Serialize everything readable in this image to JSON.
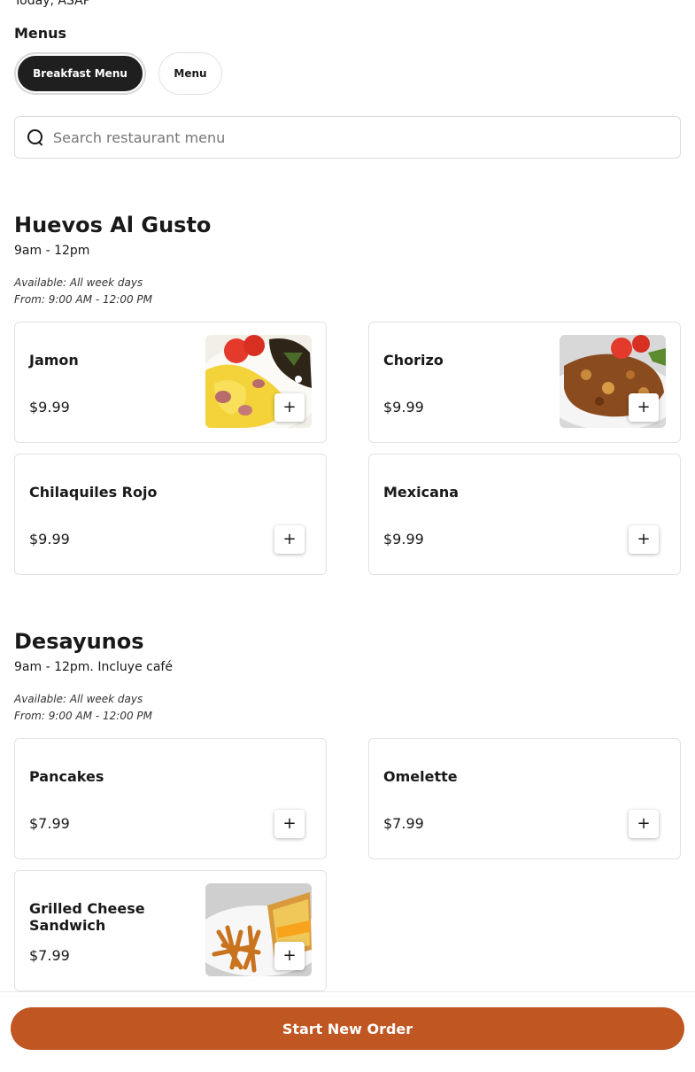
{
  "header": {
    "order_time": "Today, ASAP"
  },
  "menus": {
    "title": "Menus",
    "tabs": [
      {
        "label": "Breakfast Menu",
        "active": true
      },
      {
        "label": "Menu",
        "active": false
      }
    ]
  },
  "search": {
    "placeholder": "Search restaurant menu",
    "value": ""
  },
  "sections": [
    {
      "title": "Huevos Al Gusto",
      "description": "9am - 12pm",
      "available": "Available: All week days",
      "from": "From: 9:00 AM - 12:00 PM",
      "items": [
        {
          "name": "Jamon",
          "price": "$9.99",
          "image": "scrambled-eggs-ham-photo"
        },
        {
          "name": "Chorizo",
          "price": "$9.99",
          "image": "chorizo-eggs-photo"
        },
        {
          "name": "Chilaquiles Rojo",
          "price": "$9.99"
        },
        {
          "name": "Mexicana",
          "price": "$9.99"
        }
      ]
    },
    {
      "title": "Desayunos",
      "description": "9am - 12pm. Incluye café",
      "available": "Available: All week days",
      "from": "From: 9:00 AM - 12:00 PM",
      "items": [
        {
          "name": "Pancakes",
          "price": "$7.99"
        },
        {
          "name": "Omelette",
          "price": "$7.99"
        },
        {
          "name": "Grilled Cheese Sandwich",
          "price": "$7.99",
          "image": "grilled-cheese-fries-photo"
        }
      ]
    }
  ],
  "add_label": "+",
  "footer": {
    "start_order_label": "Start New Order"
  },
  "colors": {
    "accent": "#c05621",
    "active_pill": "#1f1f1f"
  }
}
